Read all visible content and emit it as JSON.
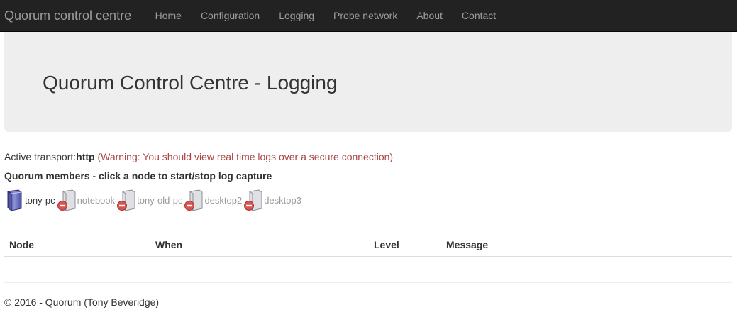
{
  "navbar": {
    "brand": "Quorum control centre",
    "links": [
      "Home",
      "Configuration",
      "Logging",
      "Probe network",
      "About",
      "Contact"
    ]
  },
  "page": {
    "title": "Quorum Control Centre - Logging"
  },
  "transport": {
    "label": "Active transport:",
    "value": "http",
    "warning": "(Warning: You should view real time logs over a secure connection)"
  },
  "members": {
    "title": "Quorum members - click a node to start/stop log capture",
    "nodes": [
      {
        "name": "tony-pc",
        "status": "online",
        "icon": "computer-icon"
      },
      {
        "name": "notebook",
        "status": "offline",
        "icon": "computer-offline-icon"
      },
      {
        "name": "tony-old-pc",
        "status": "offline",
        "icon": "computer-offline-icon"
      },
      {
        "name": "desktop2",
        "status": "offline",
        "icon": "computer-offline-icon"
      },
      {
        "name": "desktop3",
        "status": "offline",
        "icon": "computer-offline-icon"
      }
    ]
  },
  "log_table": {
    "columns": [
      "Node",
      "When",
      "Level",
      "Message"
    ],
    "rows": []
  },
  "footer": {
    "text": "© 2016 - Quorum (Tony Beveridge)"
  },
  "colors": {
    "navbar_bg": "#222222",
    "nav_text": "#9d9d9d",
    "jumbotron_bg": "#eeeeee",
    "warning": "#a94442"
  }
}
